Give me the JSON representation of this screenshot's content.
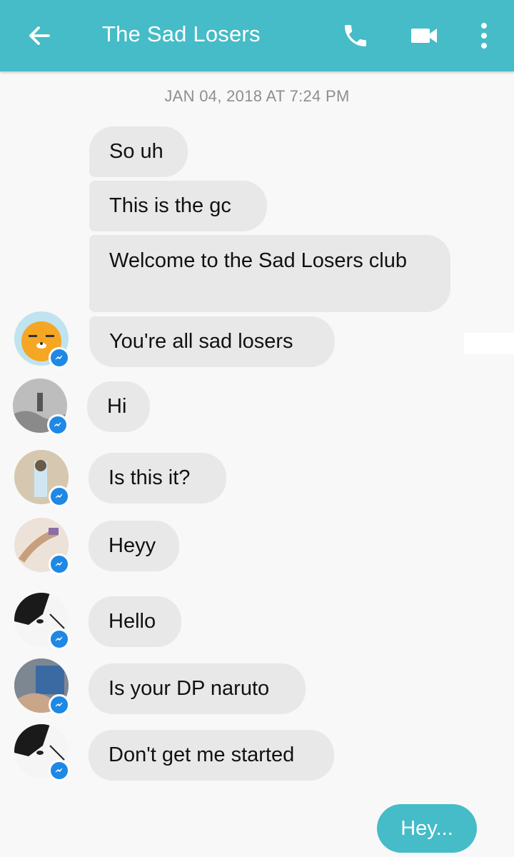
{
  "header": {
    "back_icon": "arrow-left-icon",
    "title": "The Sad Losers",
    "call_icon": "phone-icon",
    "video_icon": "video-camera-icon",
    "more_icon": "more-vertical-icon",
    "color": "#45bcc7"
  },
  "timestamp": "JAN 04, 2018 AT 7:24 PM",
  "messages": [
    {
      "text": "So uh"
    },
    {
      "text": "This is the gc"
    },
    {
      "text": "Welcome to the Sad Losers club"
    },
    {
      "text": "You're all sad losers"
    },
    {
      "text": "Hi"
    },
    {
      "text": "Is this it?"
    },
    {
      "text": "Heyy"
    },
    {
      "text": "Hello"
    },
    {
      "text": "Is your DP naruto"
    },
    {
      "text": "Don't get me started"
    }
  ],
  "avatar_badge_icon": "messenger-icon",
  "sent": {
    "text": "Hey..."
  }
}
